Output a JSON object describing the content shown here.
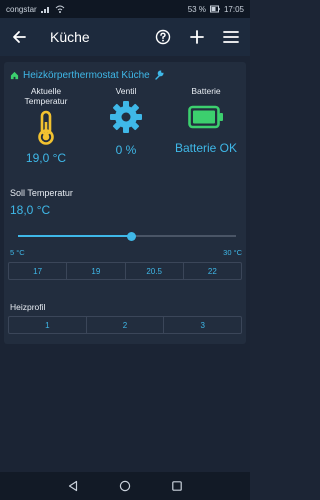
{
  "status": {
    "carrier": "congstar",
    "battery": "53 %",
    "time": "17:05"
  },
  "appbar": {
    "title": "Küche"
  },
  "device": {
    "name": "Heizkörperthermostat Küche"
  },
  "current_temp": {
    "label": "Aktuelle Temperatur",
    "value": "19,0 °C"
  },
  "valve": {
    "label": "Ventil",
    "value": "0 %"
  },
  "battery": {
    "label": "Batterie",
    "value": "Batterie OK"
  },
  "setpoint": {
    "label": "Soll Temperatur",
    "value": "18,0 °C",
    "min_label": "5 °C",
    "max_label": "30 °C",
    "level_fraction": 0.52
  },
  "presets": [
    "17",
    "19",
    "20.5",
    "22"
  ],
  "profile": {
    "label": "Heizprofil",
    "options": [
      "1",
      "2",
      "3"
    ]
  },
  "colors": {
    "accent": "#3fb8e8",
    "thermometer": "#f2c230",
    "battery_ok": "#3ccf6e"
  }
}
